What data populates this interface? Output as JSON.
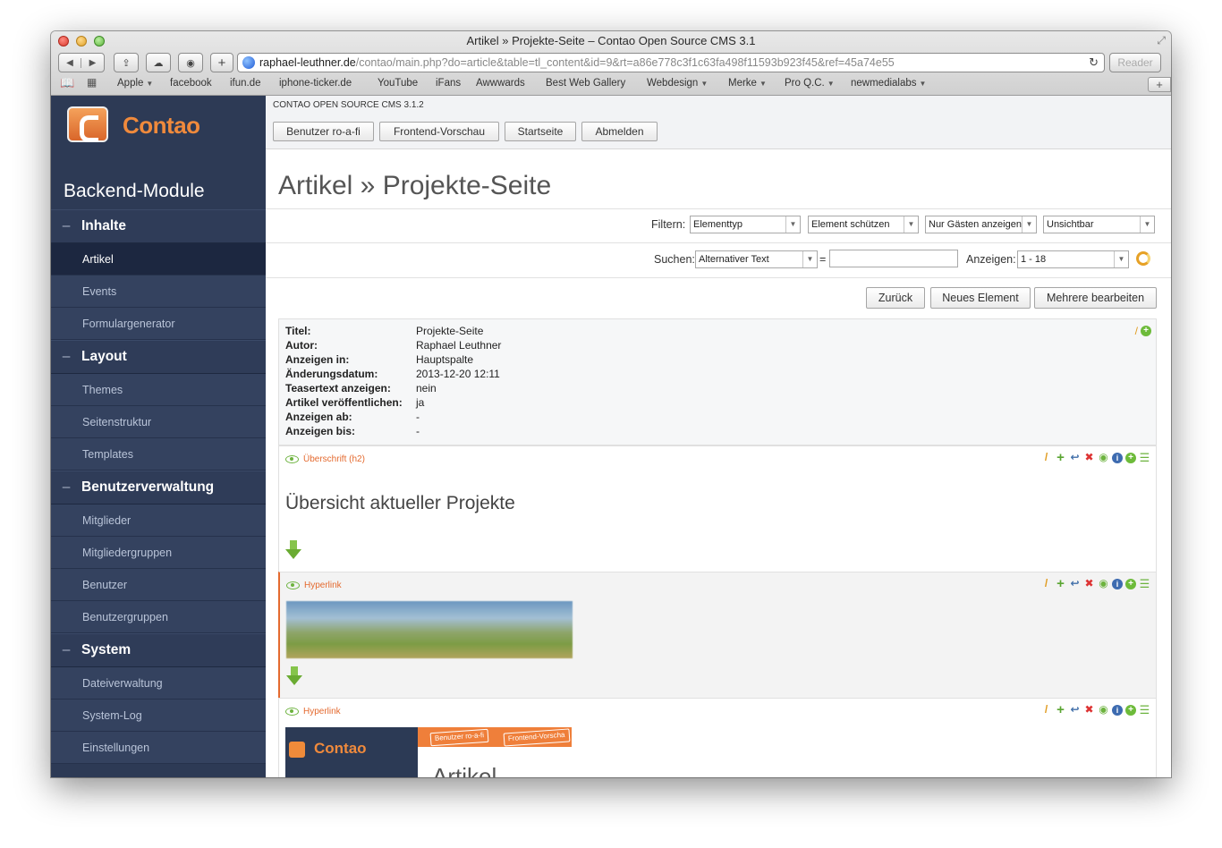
{
  "window": {
    "title": "Artikel » Projekte-Seite – Contao Open Source CMS 3.1",
    "url_domain": "raphael-leuthner.de",
    "url_path": "/contao/main.php?do=article&table=tl_content&id=9&rt=a86e778c3f1c63fa498f11593b923f45&ref=45a74e55",
    "reader_label": "Reader"
  },
  "bookmarks": [
    "Apple",
    "facebook",
    "ifun.de",
    "iphone-ticker.de",
    "YouTube",
    "iFans",
    "Awwwards",
    "Best Web Gallery",
    "Webdesign",
    "Merke",
    "Pro Q.C.",
    "newmedialabs"
  ],
  "sidebar": {
    "logo": "Contao",
    "title": "Backend-Module",
    "groups": [
      {
        "label": "Inhalte",
        "items": [
          "Artikel",
          "Events",
          "Formulargenerator"
        ]
      },
      {
        "label": "Layout",
        "items": [
          "Themes",
          "Seitenstruktur",
          "Templates"
        ]
      },
      {
        "label": "Benutzerverwaltung",
        "items": [
          "Mitglieder",
          "Mitgliedergruppen",
          "Benutzer",
          "Benutzergruppen"
        ]
      },
      {
        "label": "System",
        "items": [
          "Dateiverwaltung",
          "System-Log",
          "Einstellungen"
        ]
      }
    ]
  },
  "topbar": {
    "version": "CONTAO OPEN SOURCE CMS 3.1.2",
    "buttons": [
      "Benutzer ro-a-fi",
      "Frontend-Vorschau",
      "Startseite",
      "Abmelden"
    ]
  },
  "main": {
    "title": "Artikel » Projekte-Seite",
    "filter": {
      "label": "Filtern:",
      "selects": [
        "Elementtyp",
        "Element schützen",
        "Nur Gästen anzeigen",
        "Unsichtbar"
      ]
    },
    "search": {
      "label": "Suchen:",
      "field": "Alternativer Text",
      "equals": "=",
      "value": "",
      "show_label": "Anzeigen:",
      "show_value": "1 - 18"
    },
    "actions": [
      "Zurück",
      "Neues Element",
      "Mehrere bearbeiten"
    ],
    "meta": [
      {
        "k": "Titel:",
        "v": "Projekte-Seite"
      },
      {
        "k": "Autor:",
        "v": "Raphael Leuthner"
      },
      {
        "k": "Anzeigen in:",
        "v": "Hauptspalte"
      },
      {
        "k": "Änderungsdatum:",
        "v": "2013-12-20 12:11"
      },
      {
        "k": "Teasertext anzeigen:",
        "v": "nein"
      },
      {
        "k": "Artikel veröffentlichen:",
        "v": "ja"
      },
      {
        "k": "Anzeigen ab:",
        "v": "-"
      },
      {
        "k": "Anzeigen bis:",
        "v": "-"
      }
    ],
    "elements": [
      {
        "type": "Überschrift (h2)",
        "heading": "Übersicht aktueller Projekte"
      },
      {
        "type": "Hyperlink"
      },
      {
        "type": "Hyperlink",
        "preview_logo": "Contao",
        "preview_buttons": [
          "Benutzer ro-a-fi",
          "Frontend-Vorscha"
        ],
        "preview_heading": "Artikel"
      }
    ]
  },
  "colors": {
    "accent": "#e46a2f",
    "sidebar": "#2d3a55",
    "green": "#6db33f"
  }
}
